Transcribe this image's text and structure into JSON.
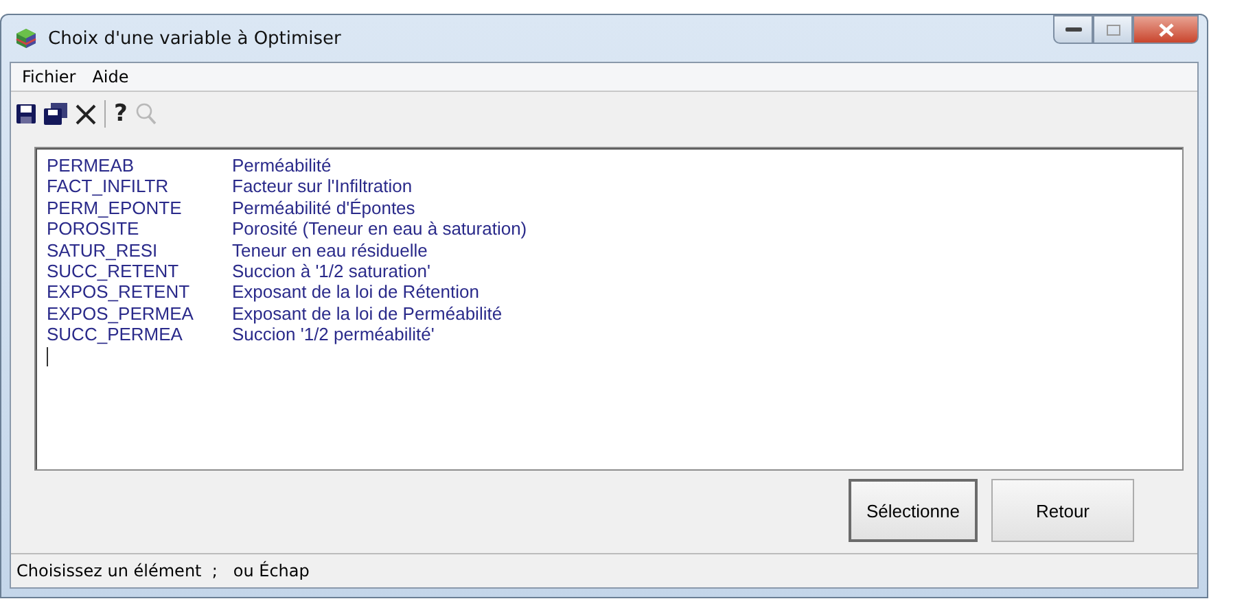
{
  "window": {
    "title": "Choix d'une variable à Optimiser"
  },
  "menu": [
    "Fichier",
    "Aide"
  ],
  "toolbar": [
    {
      "kind": "save"
    },
    {
      "kind": "save-all"
    },
    {
      "kind": "delete"
    },
    {
      "kind": "separator"
    },
    {
      "kind": "help",
      "label": "?"
    },
    {
      "kind": "search",
      "disabled": true
    }
  ],
  "list": [
    {
      "code": "PERMEAB",
      "description": "Perméabilité"
    },
    {
      "code": "FACT_INFILTR",
      "description": "Facteur sur l'Infiltration"
    },
    {
      "code": "PERM_EPONTE",
      "description": "Perméabilité d'Épontes"
    },
    {
      "code": "POROSITE",
      "description": "Porosité (Teneur en eau à saturation)"
    },
    {
      "code": "SATUR_RESI",
      "description": "Teneur en eau résiduelle"
    },
    {
      "code": "SUCC_RETENT",
      "description": "Succion à '1/2 saturation'"
    },
    {
      "code": "EXPOS_RETENT",
      "description": "Exposant de la loi de Rétention"
    },
    {
      "code": "EXPOS_PERMEA",
      "description": "Exposant de la loi de Perméabilité"
    },
    {
      "code": "SUCC_PERMEA",
      "description": "Succion '1/2 perméabilité'"
    }
  ],
  "buttons": [
    {
      "label": "Sélectionne",
      "default": true
    },
    {
      "label": "Retour",
      "default": false
    }
  ],
  "status_bar": "Choisissez un élément  ;   ou Échap"
}
